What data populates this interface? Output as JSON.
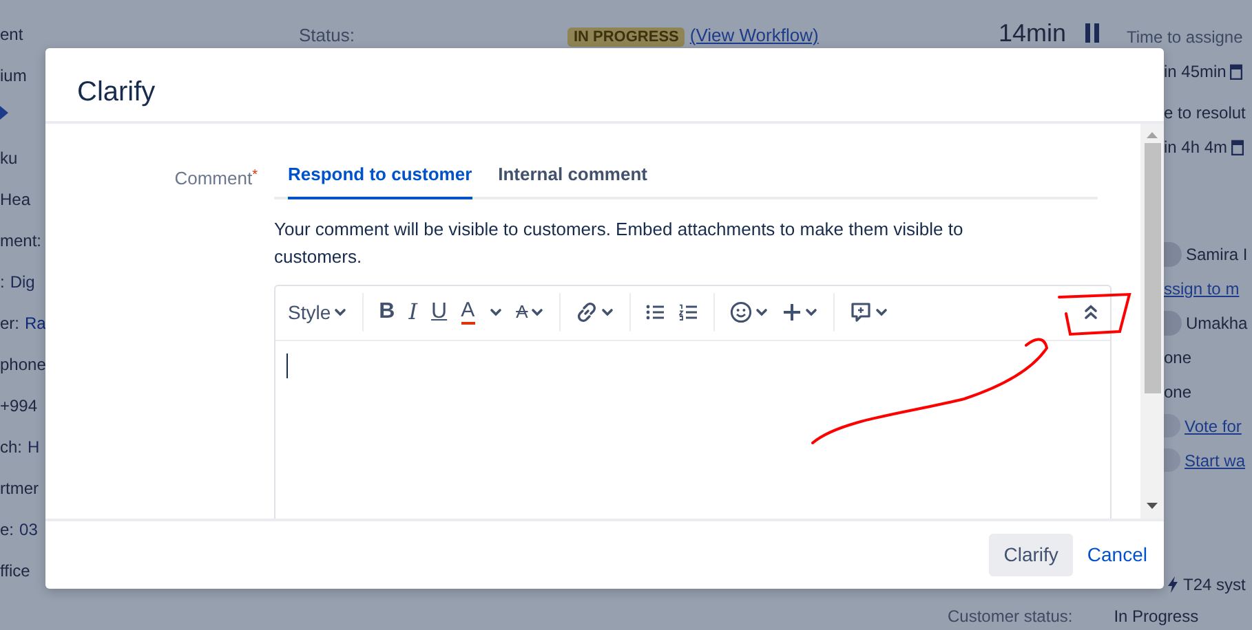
{
  "background_page": {
    "left_column": [
      {
        "kind": "text",
        "label": "ent"
      },
      {
        "kind": "text",
        "label": "ium"
      },
      {
        "kind": "marker"
      },
      {
        "kind": "text",
        "label": "ku"
      },
      {
        "kind": "text",
        "label": "Hea"
      },
      {
        "kind": "text",
        "label": "ment:"
      },
      {
        "kind": "field",
        "label": ":",
        "value": "Dig"
      },
      {
        "kind": "link",
        "label": "er:",
        "value": "Ra"
      },
      {
        "kind": "text",
        "label": "phone"
      },
      {
        "kind": "text",
        "label": "+994"
      },
      {
        "kind": "field",
        "label": "ch:",
        "value": "H"
      },
      {
        "kind": "text",
        "label": "rtmer"
      },
      {
        "kind": "field",
        "label": "e:",
        "value": "03"
      },
      {
        "kind": "text",
        "label": "ffice"
      }
    ],
    "status": {
      "label": "Status:",
      "badge": "IN PROGRESS",
      "link": "(View Workflow)"
    },
    "sla": {
      "elapsed": "14min",
      "paused": true,
      "rows": [
        {
          "kind": "heading",
          "text": "Time to assigne"
        },
        {
          "kind": "due",
          "text": "in 45min"
        },
        {
          "kind": "heading",
          "text": "e to resolut"
        },
        {
          "kind": "due",
          "text": "in 4h 4m"
        }
      ]
    },
    "people": [
      {
        "kind": "person",
        "text": "Samira I"
      },
      {
        "kind": "link",
        "text": "ssign to m"
      },
      {
        "kind": "person",
        "text": "Umakha"
      },
      {
        "kind": "plain",
        "text": "one"
      },
      {
        "kind": "plain",
        "text": "one"
      },
      {
        "kind": "counter",
        "text": "Vote for"
      },
      {
        "kind": "counter",
        "text": "Start wa"
      }
    ],
    "request_type": "T24 syst",
    "customer_status": {
      "label": "Customer status:",
      "value": "In Progress"
    }
  },
  "dialog": {
    "title": "Clarify",
    "comment_label": "Comment",
    "required_mark": "*",
    "tabs": [
      {
        "label": "Respond to customer",
        "selected": true
      },
      {
        "label": "Internal comment",
        "selected": false
      }
    ],
    "help": "Your comment will be visible to customers. Embed attachments to make them visible to customers.",
    "toolbar": [
      {
        "kind": "menu",
        "text": "Style"
      },
      {
        "kind": "separator"
      },
      {
        "kind": "bold",
        "text": "B",
        "caret": false
      },
      {
        "kind": "italic",
        "text": "I",
        "caret": false
      },
      {
        "kind": "underline",
        "text": "U",
        "caret": false
      },
      {
        "kind": "color",
        "text": "A",
        "caret": true
      },
      {
        "kind": "more",
        "text": "A",
        "caret": true
      },
      {
        "kind": "separator"
      },
      {
        "kind": "link",
        "caret": true
      },
      {
        "kind": "separator"
      },
      {
        "kind": "bullets",
        "caret": false
      },
      {
        "kind": "numbering",
        "caret": false
      },
      {
        "kind": "separator"
      },
      {
        "kind": "emoji",
        "caret": true
      },
      {
        "kind": "insert",
        "caret": true
      },
      {
        "kind": "separator"
      },
      {
        "kind": "comment",
        "caret": true
      },
      {
        "kind": "spacer"
      },
      {
        "kind": "collapse",
        "caret": false
      }
    ],
    "buttons": [
      {
        "kind": "primary",
        "label": "Clarify"
      },
      {
        "kind": "link",
        "label": "Cancel"
      }
    ]
  }
}
